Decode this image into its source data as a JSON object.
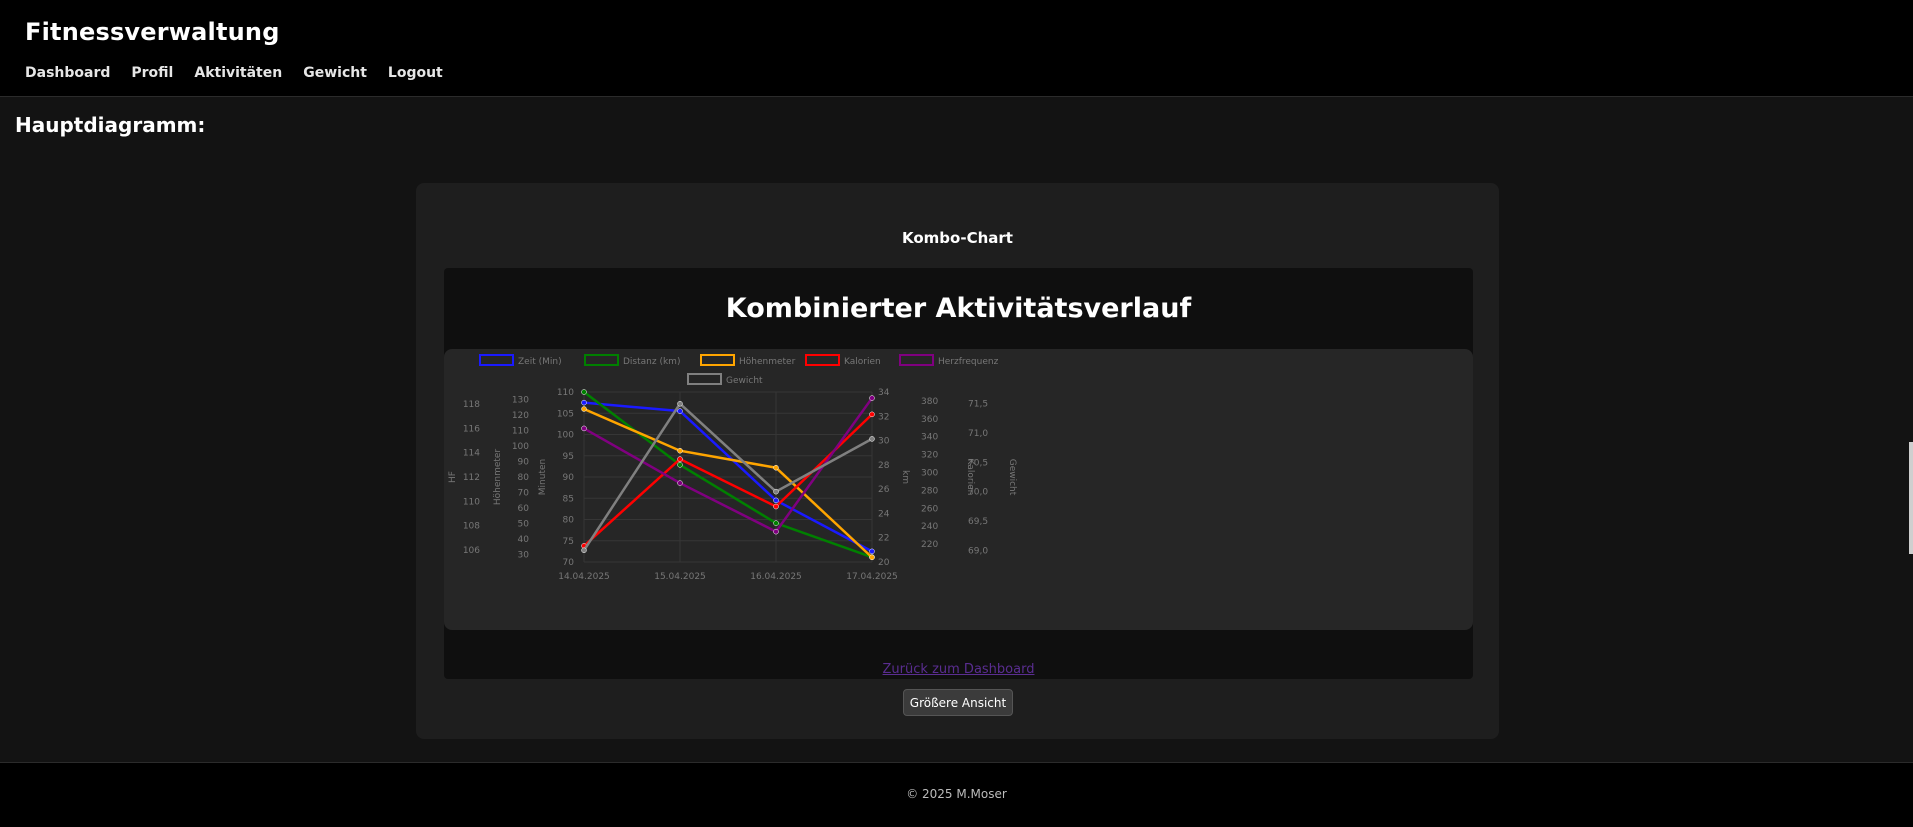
{
  "header": {
    "brand": "Fitnessverwaltung",
    "nav": [
      "Dashboard",
      "Profil",
      "Aktivitäten",
      "Gewicht",
      "Logout"
    ]
  },
  "section_title": "Hauptdiagramm:",
  "card": {
    "title": "Kombo-Chart",
    "frame_title": "Kombinierter Aktivitätsverlauf",
    "back_link": "Zurück zum Dashboard",
    "bigger_button": "Größere Ansicht"
  },
  "footer": {
    "text": "© 2025 M.Moser"
  },
  "chart_data": {
    "type": "line",
    "title": "Kombinierter Aktivitätsverlauf",
    "x": [
      "14.04.2025",
      "15.04.2025",
      "16.04.2025",
      "17.04.2025"
    ],
    "grid": true,
    "legend_position": "top",
    "axes": [
      {
        "id": "hf",
        "label": "HF",
        "range": [
          105,
          119
        ],
        "ticks": [
          106,
          108,
          110,
          112,
          114,
          116,
          118
        ]
      },
      {
        "id": "hm",
        "label": "Höhenmeter",
        "range": [
          25,
          135
        ],
        "ticks": [
          30,
          40,
          50,
          60,
          70,
          80,
          90,
          100,
          110,
          120,
          130
        ]
      },
      {
        "id": "min",
        "label": "Minuten",
        "range": [
          70,
          110
        ],
        "ticks": [
          70,
          75,
          80,
          85,
          90,
          95,
          100,
          105,
          110
        ]
      },
      {
        "id": "km",
        "label": "km",
        "range": [
          20,
          34
        ],
        "ticks": [
          20,
          22,
          24,
          26,
          28,
          30,
          32,
          34
        ]
      },
      {
        "id": "kal",
        "label": "Kalorien",
        "range": [
          200,
          390
        ],
        "ticks": [
          220,
          240,
          260,
          280,
          300,
          320,
          340,
          360,
          380
        ]
      },
      {
        "id": "gew",
        "label": "Gewicht",
        "range": [
          68.8,
          71.7
        ],
        "ticks": [
          "69,0",
          "69,5",
          "70,0",
          "70,5",
          "71,0",
          "71,5"
        ]
      }
    ],
    "series": [
      {
        "name": "Zeit (Min)",
        "axis": "min",
        "color": "#1a1aff",
        "values": [
          107.5,
          105.5,
          84.5,
          72.5
        ]
      },
      {
        "name": "Distanz (km)",
        "axis": "km",
        "color": "#008000",
        "values": [
          34,
          28,
          23.2,
          20.4
        ]
      },
      {
        "name": "Höhenmeter",
        "axis": "hm",
        "color": "#ffa500",
        "values": [
          124,
          97,
          86,
          28
        ]
      },
      {
        "name": "Kalorien",
        "axis": "kal",
        "color": "#ff0000",
        "values": [
          218,
          315,
          262,
          365
        ]
      },
      {
        "name": "Herzfrequenz",
        "axis": "hf",
        "color": "#800080",
        "values": [
          116,
          111.5,
          107.5,
          118.5
        ]
      },
      {
        "name": "Gewicht",
        "axis": "gew",
        "color": "#808080",
        "values": [
          69.0,
          71.5,
          70.0,
          70.9
        ]
      }
    ]
  }
}
